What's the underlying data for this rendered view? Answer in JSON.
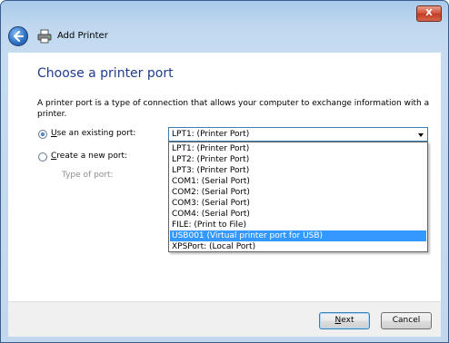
{
  "window": {
    "title": "Add Printer",
    "close_label": "X"
  },
  "page": {
    "heading": "Choose a printer port",
    "description": "A printer port is a type of connection that allows your computer to exchange information with a printer."
  },
  "port_choice": {
    "use_existing": {
      "label_underline": "U",
      "label_rest": "se an existing port:",
      "selected": true
    },
    "create_new": {
      "label_underline": "C",
      "label_rest": "reate a new port:",
      "selected": false
    },
    "type_of_port_label": "Type of port:"
  },
  "existing_port_combo": {
    "value": "LPT1: (Printer Port)",
    "options": [
      "LPT1: (Printer Port)",
      "LPT2: (Printer Port)",
      "LPT3: (Printer Port)",
      "COM1: (Serial Port)",
      "COM2: (Serial Port)",
      "COM3: (Serial Port)",
      "COM4: (Serial Port)",
      "FILE: (Print to File)",
      "USB001 (Virtual printer port for USB)",
      "XPSPort: (Local Port)"
    ],
    "highlighted_index": 8
  },
  "footer": {
    "next_underline": "N",
    "next_rest": "ext",
    "cancel_label": "Cancel"
  },
  "colors": {
    "heading": "#1e3c8c",
    "highlight": "#3399ff"
  }
}
